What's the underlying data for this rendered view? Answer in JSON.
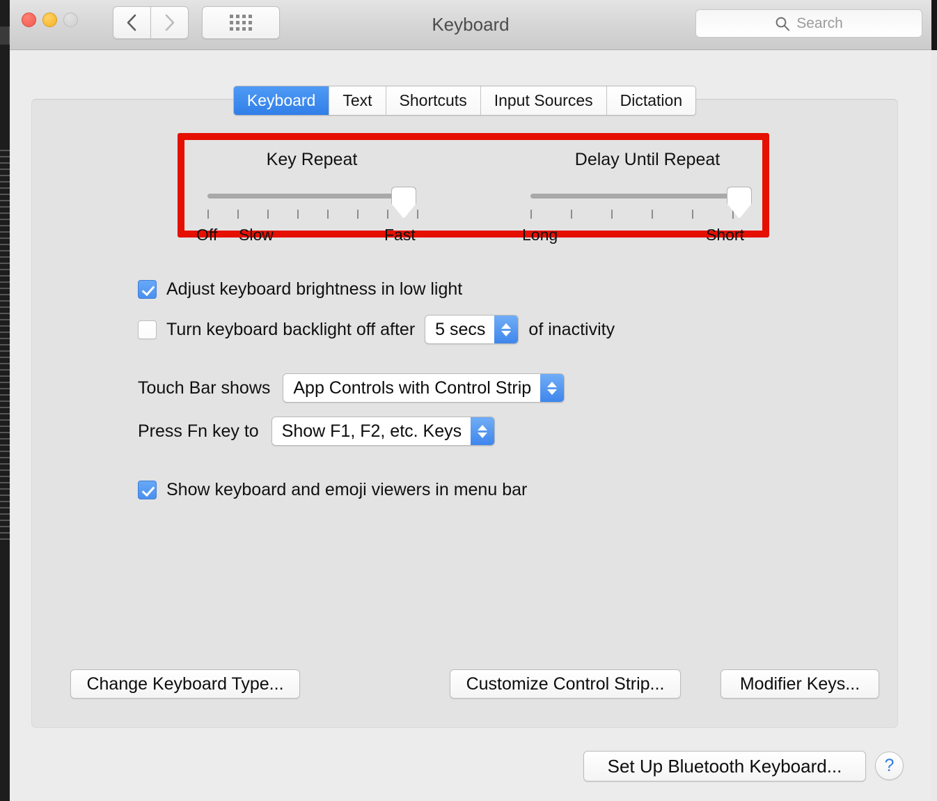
{
  "window": {
    "title": "Keyboard",
    "traffic_lights": [
      "close",
      "minimize",
      "zoom"
    ],
    "nav": {
      "back": "back-chevron",
      "forward": "forward-chevron",
      "show_all": "grid-icon"
    },
    "search": {
      "placeholder": "Search",
      "icon": "search-icon"
    }
  },
  "tabs": [
    {
      "label": "Keyboard",
      "active": true
    },
    {
      "label": "Text",
      "active": false
    },
    {
      "label": "Shortcuts",
      "active": false
    },
    {
      "label": "Input Sources",
      "active": false
    },
    {
      "label": "Dictation",
      "active": false
    }
  ],
  "highlight": {
    "color": "#e51000",
    "target": "key-repeat-and-delay-sliders"
  },
  "sliders": [
    {
      "title": "Key Repeat",
      "min_label": "Off",
      "second_label": "Slow",
      "max_label": "Fast",
      "ticks": 8,
      "value_position": "max"
    },
    {
      "title": "Delay Until Repeat",
      "min_label": "Long",
      "max_label": "Short",
      "ticks": 6,
      "value_position": "max"
    }
  ],
  "options": {
    "adjust_brightness": {
      "label": "Adjust keyboard brightness in low light",
      "checked": true
    },
    "backlight_off": {
      "label_before": "Turn keyboard backlight off after",
      "label_after": "of inactivity",
      "checked": false,
      "value": "5 secs"
    },
    "show_viewers": {
      "label": "Show keyboard and emoji viewers in menu bar",
      "checked": true
    }
  },
  "popups": {
    "touch_bar": {
      "label": "Touch Bar shows",
      "value": "App Controls with Control Strip"
    },
    "fn_key": {
      "label": "Press Fn key to",
      "value": "Show F1, F2, etc. Keys"
    }
  },
  "buttons": {
    "change_keyboard_type": "Change Keyboard Type...",
    "customize_control_strip": "Customize Control Strip...",
    "modifier_keys": "Modifier Keys...",
    "set_up_bluetooth": "Set Up Bluetooth Keyboard...",
    "help": "?"
  },
  "colors": {
    "accent_blue": "#3f86ec",
    "highlight_red": "#e51000",
    "panel_bg": "#e3e3e3",
    "window_bg": "#ececec"
  }
}
